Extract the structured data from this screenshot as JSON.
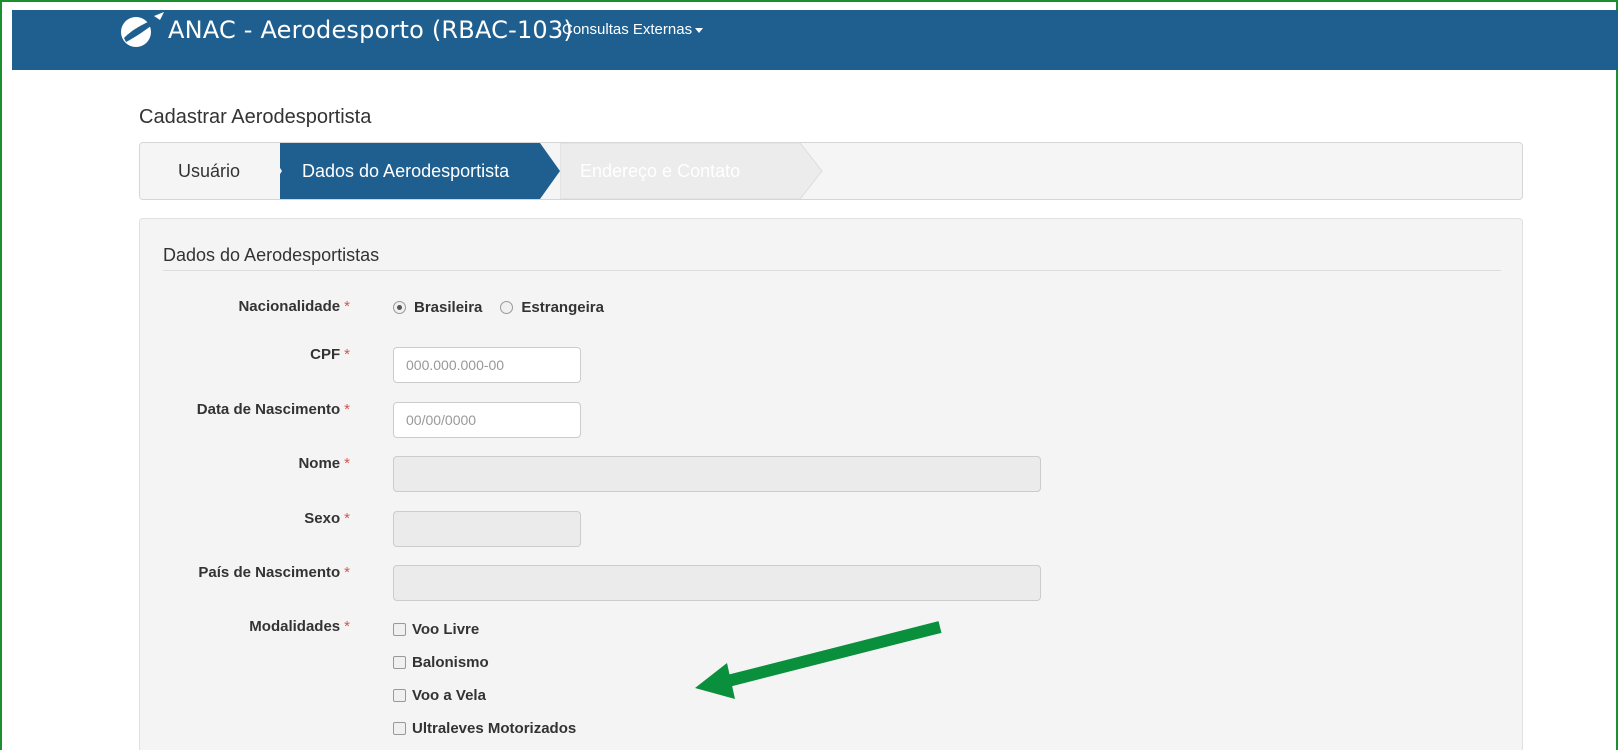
{
  "header": {
    "brand_text": "ANAC - Aerodesporto (RBAC-103)",
    "menu_label": "Consultas Externas"
  },
  "page": {
    "title": "Cadastrar Aerodesportista"
  },
  "wizard": {
    "steps": [
      {
        "label": "Usuário",
        "state": "done"
      },
      {
        "label": "Dados do Aerodesportista",
        "state": "active"
      },
      {
        "label": "Endereço e Contato",
        "state": "pending"
      }
    ]
  },
  "form": {
    "legend": "Dados do Aerodesportistas",
    "nacionalidade": {
      "label": "Nacionalidade",
      "options": [
        "Brasileira",
        "Estrangeira"
      ],
      "selected": "Brasileira"
    },
    "cpf": {
      "label": "CPF",
      "placeholder": "000.000.000-00",
      "value": ""
    },
    "data_nascimento": {
      "label": "Data de Nascimento",
      "placeholder": "00/00/0000",
      "value": ""
    },
    "nome": {
      "label": "Nome",
      "value": ""
    },
    "sexo": {
      "label": "Sexo",
      "value": ""
    },
    "pais_nascimento": {
      "label": "País de Nascimento",
      "value": ""
    },
    "modalidades": {
      "label": "Modalidades",
      "options": [
        "Voo Livre",
        "Balonismo",
        "Voo a Vela",
        "Ultraleves Motorizados"
      ]
    },
    "required_marker": "*"
  },
  "colors": {
    "navbar": "#1f5f8f",
    "active_step": "#1f5f8f",
    "pending_step": "#ececec",
    "required": "#d9534f",
    "annotation_arrow": "#0a8f3c"
  }
}
